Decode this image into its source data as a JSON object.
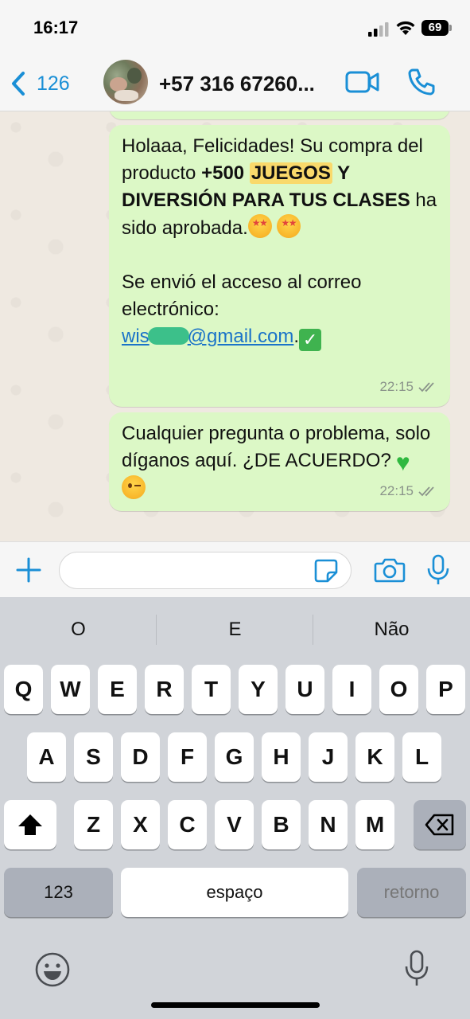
{
  "status_bar": {
    "time": "16:17",
    "battery": "69"
  },
  "header": {
    "back_count": "126",
    "contact_name": "+57 316 67260..."
  },
  "messages": [
    {
      "segments": {
        "s1": "Holaaa, Felicidades! Su compra del producto ",
        "s2": "+500 ",
        "s3": "JUEGOS",
        "s4": " Y DIVERSIÓN PARA TUS CLASES",
        "s5": " ha sido aprobada.",
        "s6": "Se envió el acceso al correo electrónico:",
        "email_start": "wis",
        "email_end": "@gmail.com",
        "s7": "."
      },
      "time": "22:15"
    },
    {
      "segments": {
        "s1": "Cualquier pregunta o problema, solo díganos aquí. ¿DE ACUERDO?"
      },
      "time": "22:15"
    }
  ],
  "keyboard": {
    "suggestions": [
      "O",
      "E",
      "Não"
    ],
    "row1": [
      "Q",
      "W",
      "E",
      "R",
      "T",
      "Y",
      "U",
      "I",
      "O",
      "P"
    ],
    "row2": [
      "A",
      "S",
      "D",
      "F",
      "G",
      "H",
      "J",
      "K",
      "L"
    ],
    "row3": [
      "Z",
      "X",
      "C",
      "V",
      "B",
      "N",
      "M"
    ],
    "numbers_label": "123",
    "space_label": "espaço",
    "return_label": "retorno"
  },
  "colors": {
    "accent": "#1a8fd6",
    "bubble": "#dcf8c6",
    "highlight": "#f9d96b",
    "link": "#1a73c8"
  }
}
